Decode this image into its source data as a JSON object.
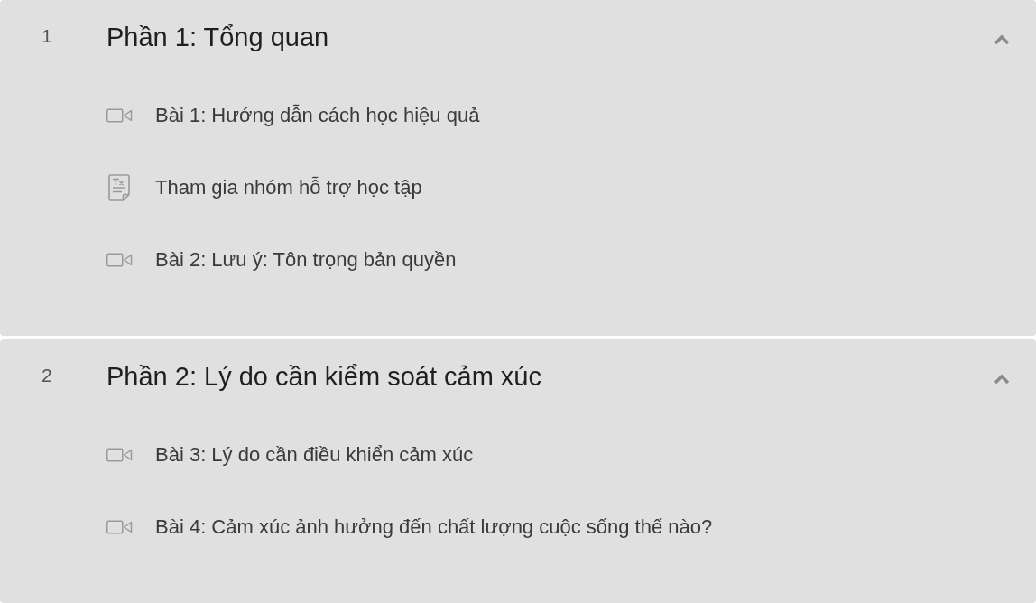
{
  "sections": [
    {
      "number": "1",
      "title": "Phần 1: Tổng quan",
      "expanded": true,
      "lessons": [
        {
          "kind": "video",
          "title": "Bài 1: Hướng dẫn cách học hiệu quả"
        },
        {
          "kind": "document",
          "title": "Tham gia nhóm hỗ trợ học tập"
        },
        {
          "kind": "video",
          "title": "Bài 2: Lưu ý: Tôn trọng bản quyền"
        }
      ]
    },
    {
      "number": "2",
      "title": "Phần 2: Lý do cần kiểm soát cảm xúc",
      "expanded": true,
      "lessons": [
        {
          "kind": "video",
          "title": "Bài 3: Lý do cần điều khiển cảm xúc"
        },
        {
          "kind": "video",
          "title": "Bài 4: Cảm xúc ảnh hưởng đến chất lượng cuộc sống thế nào?"
        }
      ]
    }
  ]
}
